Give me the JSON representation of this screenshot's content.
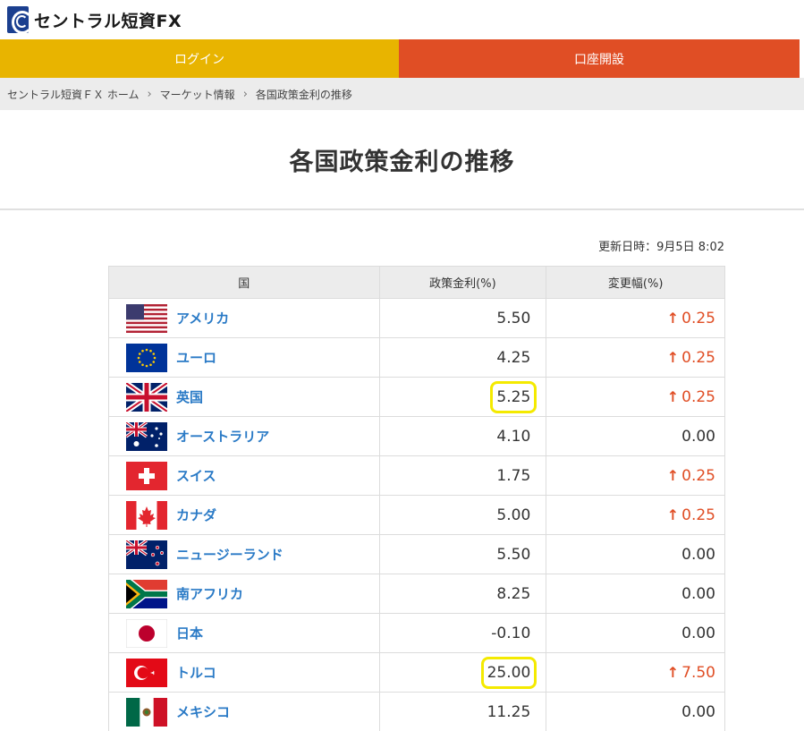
{
  "header": {
    "logo_text": "セントラル短資FX",
    "login_label": "ログイン",
    "open_account_label": "口座開設"
  },
  "breadcrumb": [
    "セントラル短資ＦＸ ホーム",
    "マーケット情報",
    "各国政策金利の推移"
  ],
  "page": {
    "title": "各国政策金利の推移",
    "updated": "更新日時：9月5日 8:02"
  },
  "table": {
    "headers": [
      "国",
      "政策金利(%)",
      "変更幅(%)"
    ],
    "rows": [
      {
        "country": "アメリカ",
        "flag": "us-flag-icon",
        "rate": "5.50",
        "change": "0.25",
        "up": true,
        "highlight": false
      },
      {
        "country": "ユーロ",
        "flag": "eu-flag-icon",
        "rate": "4.25",
        "change": "0.25",
        "up": true,
        "highlight": false
      },
      {
        "country": "英国",
        "flag": "uk-flag-icon",
        "rate": "5.25",
        "change": "0.25",
        "up": true,
        "highlight": true
      },
      {
        "country": "オーストラリア",
        "flag": "au-flag-icon",
        "rate": "4.10",
        "change": "0.00",
        "up": false,
        "highlight": false
      },
      {
        "country": "スイス",
        "flag": "ch-flag-icon",
        "rate": "1.75",
        "change": "0.25",
        "up": true,
        "highlight": false
      },
      {
        "country": "カナダ",
        "flag": "ca-flag-icon",
        "rate": "5.00",
        "change": "0.25",
        "up": true,
        "highlight": false
      },
      {
        "country": "ニュージーランド",
        "flag": "nz-flag-icon",
        "rate": "5.50",
        "change": "0.00",
        "up": false,
        "highlight": false
      },
      {
        "country": "南アフリカ",
        "flag": "za-flag-icon",
        "rate": "8.25",
        "change": "0.00",
        "up": false,
        "highlight": false
      },
      {
        "country": "日本",
        "flag": "jp-flag-icon",
        "rate": "-0.10",
        "change": "0.00",
        "up": false,
        "highlight": false
      },
      {
        "country": "トルコ",
        "flag": "tr-flag-icon",
        "rate": "25.00",
        "change": "7.50",
        "up": true,
        "highlight": true
      },
      {
        "country": "メキシコ",
        "flag": "mx-flag-icon",
        "rate": "11.25",
        "change": "0.00",
        "up": false,
        "highlight": false
      }
    ]
  },
  "colors": {
    "login": "#e8b400",
    "open_account": "#e04e25",
    "link": "#2a7ac6",
    "up": "#e04e25",
    "highlight": "#f4ea00"
  }
}
